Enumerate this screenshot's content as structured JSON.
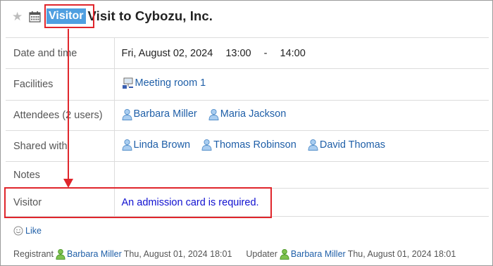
{
  "header": {
    "badge": "Visitor",
    "title": "Visit to Cybozu, Inc."
  },
  "rows": {
    "datetime": {
      "label": "Date and time",
      "date": "Fri, August 02, 2024",
      "start": "13:00",
      "sep": "-",
      "end": "14:00"
    },
    "facilities": {
      "label": "Facilities",
      "items": [
        "Meeting room 1"
      ]
    },
    "attendees": {
      "label": "Attendees (2 users)",
      "users": [
        "Barbara Miller",
        "Maria Jackson"
      ]
    },
    "shared": {
      "label": "Shared with",
      "users": [
        "Linda Brown",
        "Thomas Robinson",
        "David Thomas"
      ]
    },
    "notes": {
      "label": "Notes",
      "value": ""
    },
    "visitor": {
      "label": "Visitor",
      "value": "An admission card is required."
    }
  },
  "like": {
    "label": "Like"
  },
  "footer": {
    "registrant_label": "Registrant",
    "registrant_user": "Barbara Miller",
    "registrant_time": "Thu, August 01, 2024 18:01",
    "updater_label": "Updater",
    "updater_user": "Barbara Miller",
    "updater_time": "Thu, August 01, 2024 18:01"
  },
  "colors": {
    "badge": "#4f9fe0",
    "link": "#1f5fa8",
    "highlight": "#e0262c",
    "user_icon": "#7fb2e5",
    "registrant_icon": "#5cb531"
  },
  "icons": [
    "star-icon",
    "calendar-icon",
    "facility-icon",
    "user-icon",
    "like-icon"
  ]
}
